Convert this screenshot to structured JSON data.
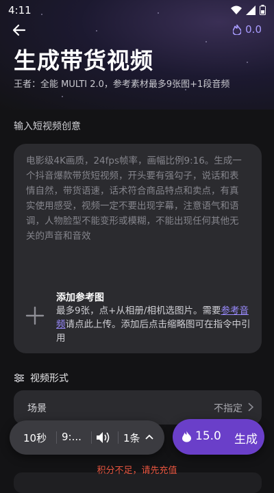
{
  "status_bar": {
    "time": "4:11"
  },
  "header": {
    "points_value": "0.0",
    "title": "生成带货视频",
    "subtitle": "王者：全能 MULTI 2.0，参考素材最多9张图+1段音频"
  },
  "prompt": {
    "section_label": "输入短视频创意",
    "text": "电影级4K画质，24fps帧率，画幅比例9:16。生成一个抖音爆款带货短视频，开头要有强勾子，说话和表情自然，带货语速，话术符合商品特点和卖点，有真实使用感受，视频一定不要出现字幕，注意语气和语调，人物脸型不能变形或模糊，不能出现任何其他无关的声音和音效"
  },
  "reference": {
    "title": "添加参考图",
    "desc_before": "最多9张，点+从相册/相机选图片。需要",
    "link": "参考音频",
    "desc_after": "请点此上传。添加后点击缩略图可在指令中引用"
  },
  "format": {
    "section_label": "视频形式",
    "scene_key": "场景",
    "scene_value": "不指定"
  },
  "toolbar": {
    "duration": "10秒",
    "ratio": "9:...",
    "count": "1条"
  },
  "generate": {
    "cost": "15.0",
    "label": "生成"
  },
  "warning": "积分不足，请先充值",
  "colors": {
    "accent": "#6a3fc9",
    "link": "#9a8bff",
    "warning": "#e8553f"
  }
}
